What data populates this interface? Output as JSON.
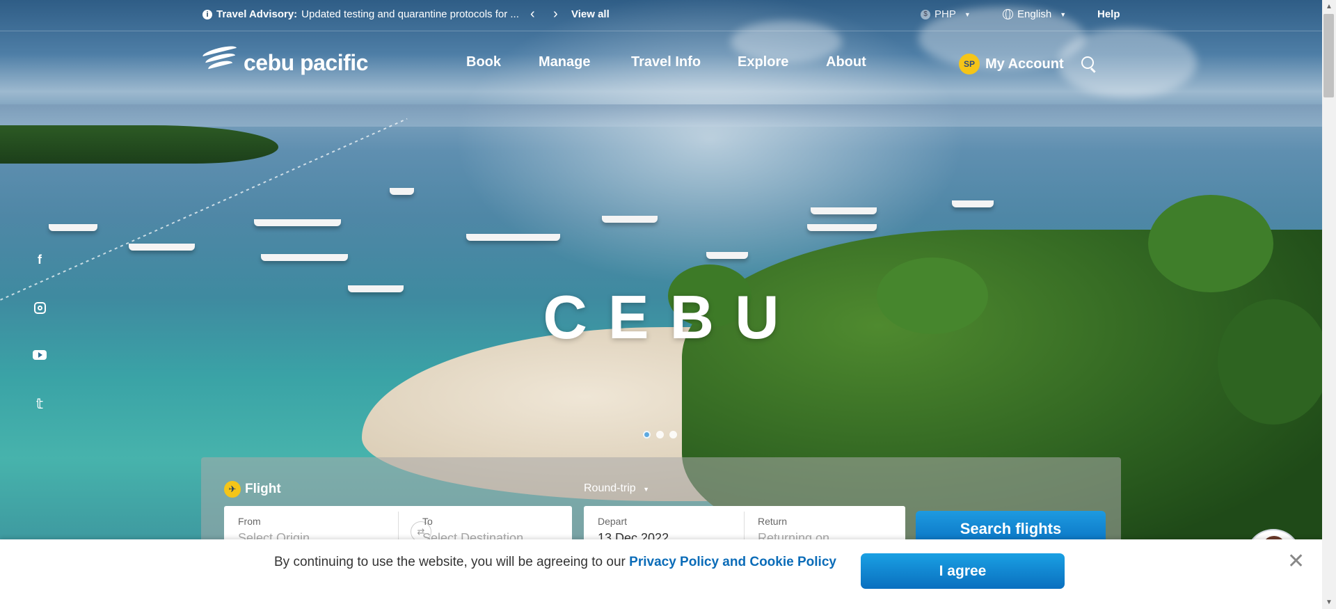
{
  "advisory": {
    "label": "Travel Advisory:",
    "text": "Updated testing and quarantine protocols for ...",
    "view_all": "View all"
  },
  "utility": {
    "currency": "PHP",
    "language": "English",
    "help": "Help"
  },
  "brand": {
    "logo_text": "cebu pacific"
  },
  "nav": {
    "items": [
      "Book",
      "Manage",
      "Travel Info",
      "Explore",
      "About"
    ],
    "account_initials": "SP",
    "account_label": "My Account"
  },
  "social": [
    "facebook-icon",
    "instagram-icon",
    "youtube-icon",
    "twitter-icon"
  ],
  "hero": {
    "title": "CEBU",
    "slides": 3,
    "active_slide": 1
  },
  "booking": {
    "tab_label": "Flight",
    "trip_type": "Round-trip",
    "from_label": "From",
    "from_placeholder": "Select Origin",
    "to_label": "To",
    "to_placeholder": "Select Destination",
    "depart_label": "Depart",
    "depart_value": "13 Dec 2022",
    "return_label": "Return",
    "return_placeholder": "Returning on",
    "search_button": "Search flights"
  },
  "cookie": {
    "text": "By continuing to use the website, you will be agreeing to our ",
    "link": "Privacy Policy and Cookie Policy",
    "button": "I agree"
  },
  "colors": {
    "accent_blue": "#0c78c7",
    "brand_yellow": "#f5c518",
    "link_blue": "#0b6cb8"
  }
}
